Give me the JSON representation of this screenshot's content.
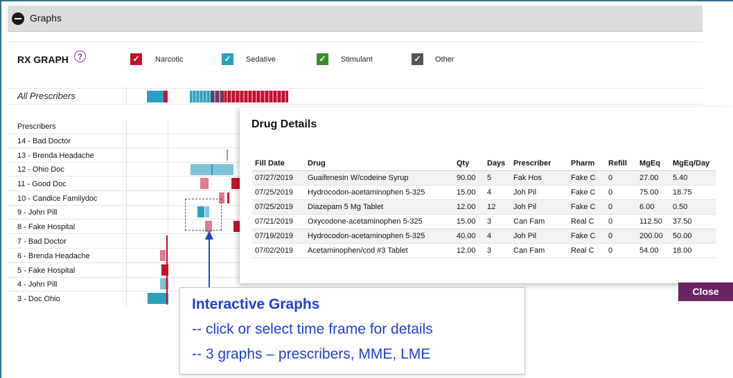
{
  "header": {
    "title": "Graphs"
  },
  "legend": {
    "title": "RX GRAPH",
    "help_symbol": "?",
    "items": [
      {
        "label": "Narcotic",
        "color": "#c8102e"
      },
      {
        "label": "Sedative",
        "color": "#2a9fbf"
      },
      {
        "label": "Stimulant",
        "color": "#3a8f2a"
      },
      {
        "label": "Other",
        "color": "#555555"
      }
    ]
  },
  "all_prescribers_label": "All Prescribers",
  "prescribers": {
    "header": "Prescribers",
    "items": [
      "14 - Bad Doctor",
      "13 - Brenda Headache",
      "12 - Ohio Doc",
      "11 - Good Doc",
      "10 - Candice Familydoc",
      "9 - John Pill",
      "8 - Fake Hospital",
      "7 - Bad Doctor",
      "6 - Brenda Headache",
      "5 - Fake Hospital",
      "4 - John Pill",
      "3 - Doc Ohio"
    ]
  },
  "modal": {
    "title": "Drug Details",
    "columns": [
      "Fill Date",
      "Drug",
      "Qty",
      "Days",
      "Prescriber",
      "Pharm",
      "Refill",
      "MgEq",
      "MgEq/Day"
    ],
    "rows": [
      [
        "07/27/2019",
        "Guaifenesin W/codeine Syrup",
        "90.00",
        "5",
        "Fak Hos",
        "Fake C",
        "0",
        "27.00",
        "5.40"
      ],
      [
        "07/25/2019",
        "Hydrocodon-acetaminophen 5-325",
        "15.00",
        "4",
        "Joh Pil",
        "Fake C",
        "0",
        "75.00",
        "18.75"
      ],
      [
        "07/25/2019",
        "Diazepam 5 Mg Tablet",
        "12.00",
        "12",
        "Joh Pil",
        "Fake C",
        "0",
        "6.00",
        "0.50"
      ],
      [
        "07/21/2019",
        "Oxycodone-acetaminophen 5-325",
        "15.00",
        "3",
        "Can Fam",
        "Real C",
        "0",
        "112.50",
        "37.50"
      ],
      [
        "07/19/2019",
        "Hydrocodon-acetaminophen 5-325",
        "40.00",
        "4",
        "Joh Pil",
        "Fake C",
        "0",
        "200.00",
        "50.00"
      ],
      [
        "07/02/2019",
        "Acetaminophen/cod #3 Tablet",
        "12.00",
        "3",
        "Can Fam",
        "Real C",
        "0",
        "54.00",
        "18.00"
      ]
    ],
    "close_label": "Close"
  },
  "callout": {
    "title": "Interactive Graphs",
    "line1": "-- click or select time frame for details",
    "line2": "-- 3 graphs – prescribers, MME, LME"
  }
}
